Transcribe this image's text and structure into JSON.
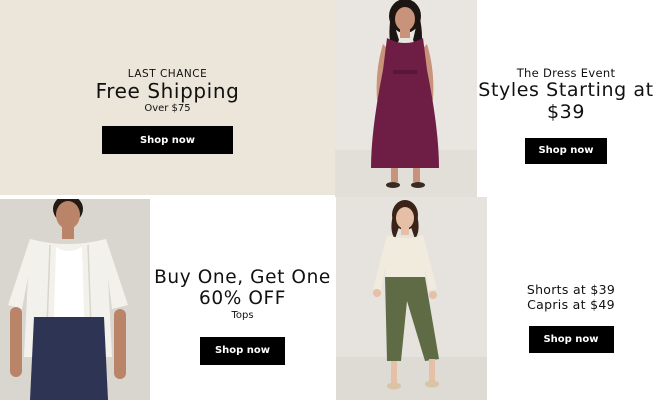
{
  "shipping": {
    "kicker": "LAST CHANCE",
    "headline": "Free Shipping",
    "sub": "Over $75",
    "cta": "Shop now"
  },
  "dress": {
    "kicker": "The Dress Event",
    "headline_line1": "Styles Starting at",
    "headline_line2": "$39",
    "cta": "Shop now"
  },
  "bogo": {
    "headline_line1": "Buy One, Get One",
    "headline_line2": "60% OFF",
    "sub": "Tops",
    "cta": "Shop now"
  },
  "shorts": {
    "line1": "Shorts at $39",
    "line2": "Capris at $49",
    "cta": "Shop now"
  },
  "colors": {
    "shipping_bg": "#ebe5da",
    "button": "#000000",
    "dress_color": "#6e1d45",
    "pants_color": "#5e6b45"
  }
}
